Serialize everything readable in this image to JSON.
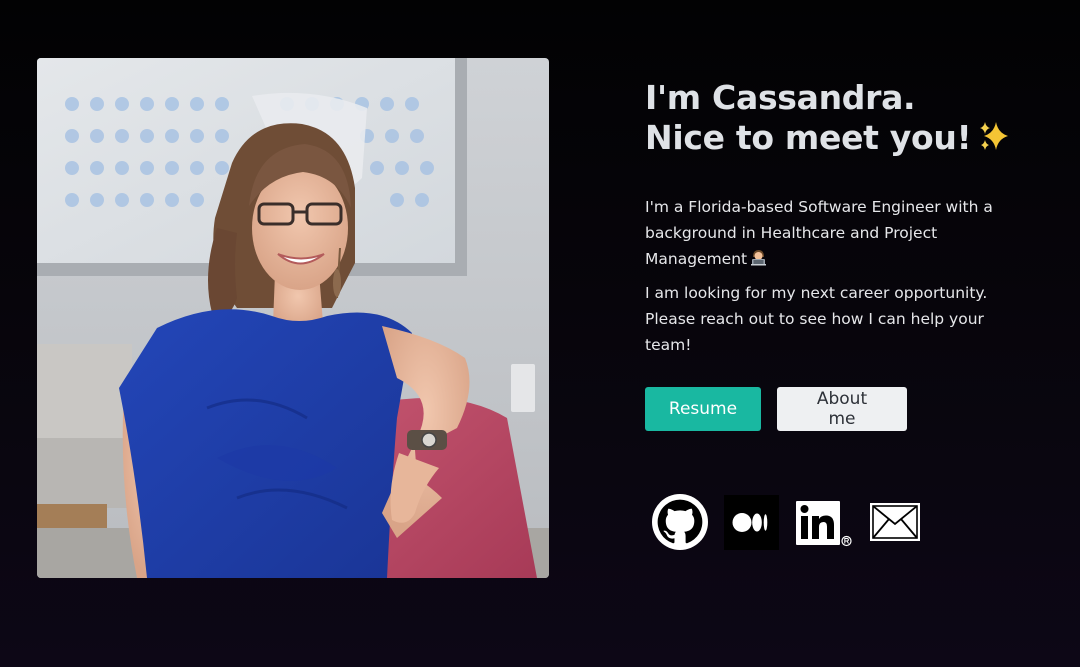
{
  "profile": {
    "photo_alt": "Cassandra smiling, seated on a pink chair"
  },
  "intro": {
    "headline_line1": "I'm Cassandra.",
    "headline_line2": "Nice to meet you!",
    "headline_emoji": "sparkles-icon",
    "bio_paragraph1": "I'm a Florida-based Software Engineer with a background in Healthcare and Project Management",
    "bio_paragraph1_emoji": "technologist-icon",
    "bio_paragraph2": "I am looking for my next career opportunity. Please reach out to see how I can help your team!"
  },
  "buttons": {
    "resume_label": "Resume",
    "about_label": "About me"
  },
  "socials": [
    {
      "name": "GitHub",
      "icon": "github-icon"
    },
    {
      "name": "Medium",
      "icon": "medium-icon"
    },
    {
      "name": "LinkedIn",
      "icon": "linkedin-icon"
    },
    {
      "name": "Email",
      "icon": "mail-icon"
    }
  ],
  "colors": {
    "background": "#05030a",
    "accent": "#19b8a1",
    "secondary_button": "#eef0f2",
    "headline_text": "#dfe2e6"
  }
}
